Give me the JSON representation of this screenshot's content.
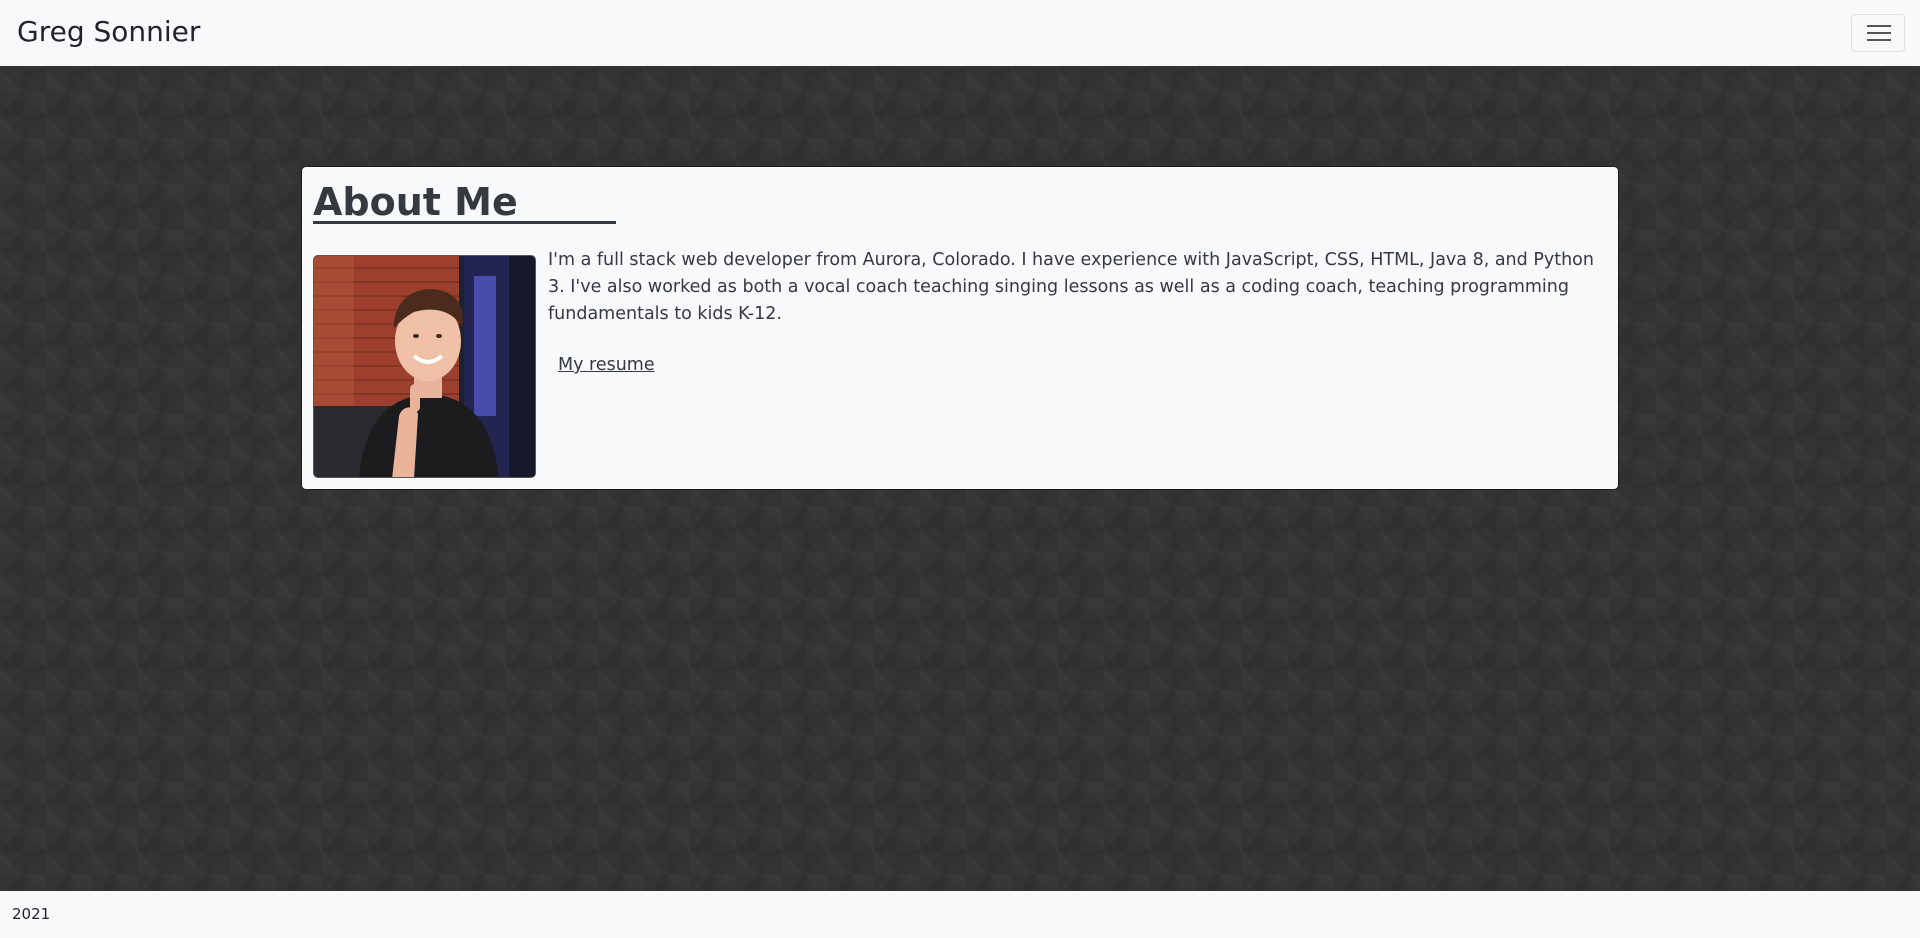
{
  "navbar": {
    "brand": "Greg Sonnier",
    "toggler_icon": "hamburger-menu-icon"
  },
  "about": {
    "title": "About Me",
    "photo_alt": "photo",
    "text": "I'm a full stack web developer from Aurora, Colorado. I have experience with JavaScript, CSS, HTML, Java 8, and Python 3. I've also worked as both a vocal coach teaching singing lessons as well as a coding coach, teaching programming fundamentals to kids K-12.",
    "resume_link": "My resume"
  },
  "footer": {
    "text": "2021"
  },
  "colors": {
    "background": "#333333",
    "surface": "#f8f9fa",
    "text": "#343a40"
  }
}
